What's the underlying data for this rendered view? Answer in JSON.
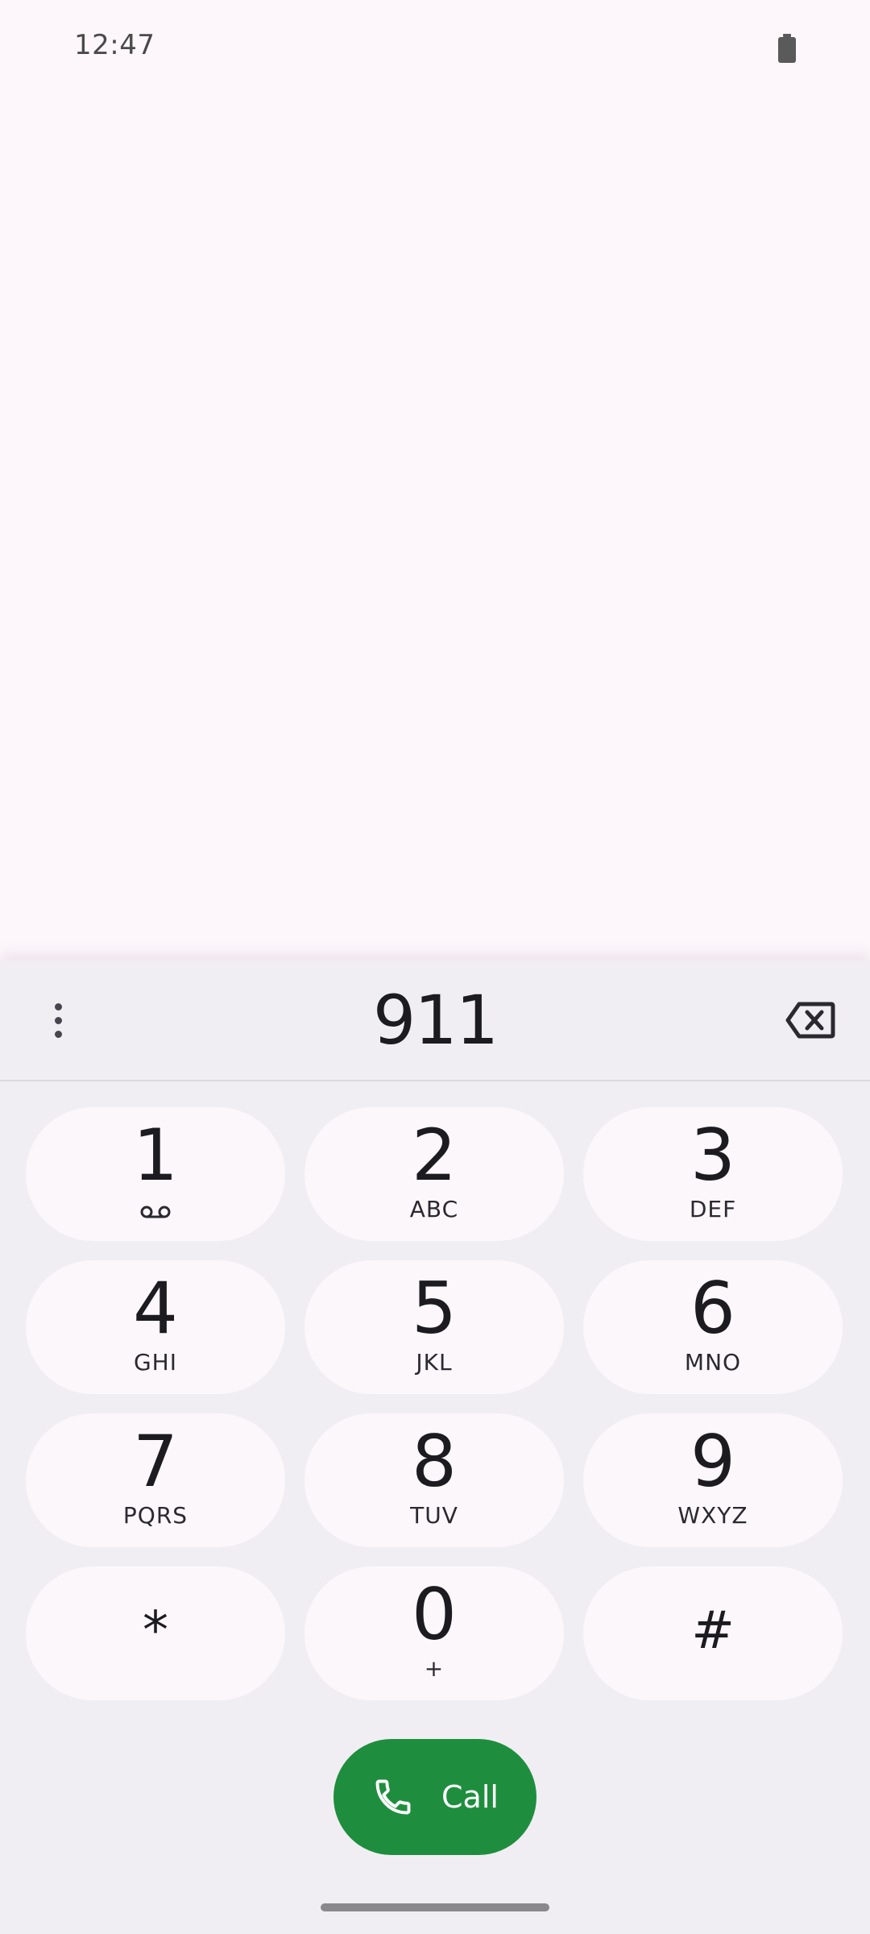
{
  "status_bar": {
    "time": "12:47",
    "battery_icon": "battery-full-icon"
  },
  "dialer": {
    "digits": "911",
    "overflow_icon": "more-vert-icon",
    "backspace_icon": "backspace-icon",
    "keys": [
      {
        "num": "1",
        "letters": "",
        "icon": "voicemail-icon"
      },
      {
        "num": "2",
        "letters": "ABC"
      },
      {
        "num": "3",
        "letters": "DEF"
      },
      {
        "num": "4",
        "letters": "GHI"
      },
      {
        "num": "5",
        "letters": "JKL"
      },
      {
        "num": "6",
        "letters": "MNO"
      },
      {
        "num": "7",
        "letters": "PQRS"
      },
      {
        "num": "8",
        "letters": "TUV"
      },
      {
        "num": "9",
        "letters": "WXYZ"
      },
      {
        "num": "*",
        "letters": ""
      },
      {
        "num": "0",
        "letters": "+"
      },
      {
        "num": "#",
        "letters": ""
      }
    ],
    "call_label": "Call",
    "call_icon": "phone-icon"
  },
  "colors": {
    "background": "#fdf7fc",
    "sheet": "#f1eef3",
    "key": "#fcf7fb",
    "call_green": "#1e8e3e"
  }
}
